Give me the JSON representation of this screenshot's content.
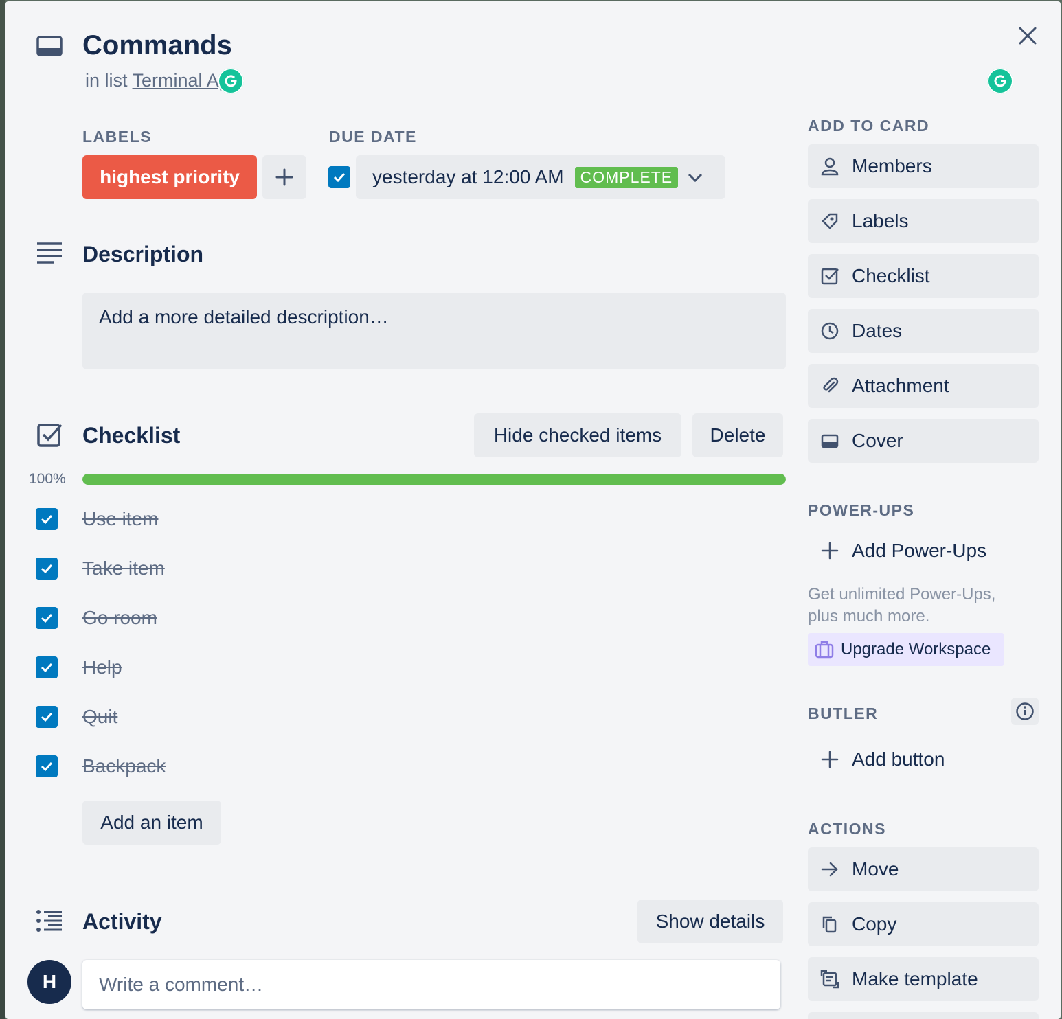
{
  "card": {
    "title": "Commands",
    "list_prefix": "in list",
    "list_name": "Terminal App"
  },
  "labels": {
    "heading": "LABELS",
    "items": [
      "highest priority"
    ],
    "label_color": "#eb5a46"
  },
  "due_date": {
    "heading": "DUE DATE",
    "value": "yesterday at 12:00 AM",
    "status": "COMPLETE",
    "checked": true
  },
  "description": {
    "heading": "Description",
    "placeholder": "Add a more detailed description…"
  },
  "checklist": {
    "heading": "Checklist",
    "hide_checked_label": "Hide checked items",
    "delete_label": "Delete",
    "progress_text": "100%",
    "progress": 1.0,
    "progress_color": "#61bd4f",
    "items": [
      {
        "text": "Use item",
        "checked": true
      },
      {
        "text": "Take item",
        "checked": true
      },
      {
        "text": "Go room",
        "checked": true
      },
      {
        "text": "Help",
        "checked": true
      },
      {
        "text": "Quit",
        "checked": true
      },
      {
        "text": "Backpack",
        "checked": true
      }
    ],
    "add_item_label": "Add an item"
  },
  "activity": {
    "heading": "Activity",
    "show_details_label": "Show details",
    "avatar_initial": "H",
    "comment_placeholder": "Write a comment…"
  },
  "sidebar": {
    "add_to_card_heading": "ADD TO CARD",
    "add_to_card": [
      {
        "label": "Members",
        "icon": "person-icon"
      },
      {
        "label": "Labels",
        "icon": "tag-icon"
      },
      {
        "label": "Checklist",
        "icon": "checkbox-icon"
      },
      {
        "label": "Dates",
        "icon": "clock-icon"
      },
      {
        "label": "Attachment",
        "icon": "paperclip-icon"
      },
      {
        "label": "Cover",
        "icon": "card-cover-icon"
      }
    ],
    "powerups_heading": "POWER-UPS",
    "add_powerups_label": "Add Power-Ups",
    "powerups_note": "Get unlimited Power-Ups, plus much more.",
    "upgrade_label": "Upgrade Workspace",
    "butler_heading": "BUTLER",
    "add_button_label": "Add button",
    "actions_heading": "ACTIONS",
    "actions": [
      {
        "label": "Move",
        "icon": "arrow-right-icon"
      },
      {
        "label": "Copy",
        "icon": "copy-icon"
      },
      {
        "label": "Make template",
        "icon": "template-icon"
      }
    ]
  },
  "colors": {
    "accent_blue": "#0079bf",
    "modal_bg": "#f4f5f7",
    "button_bg": "#e9ebee",
    "upgrade_bg": "#eae6ff"
  }
}
